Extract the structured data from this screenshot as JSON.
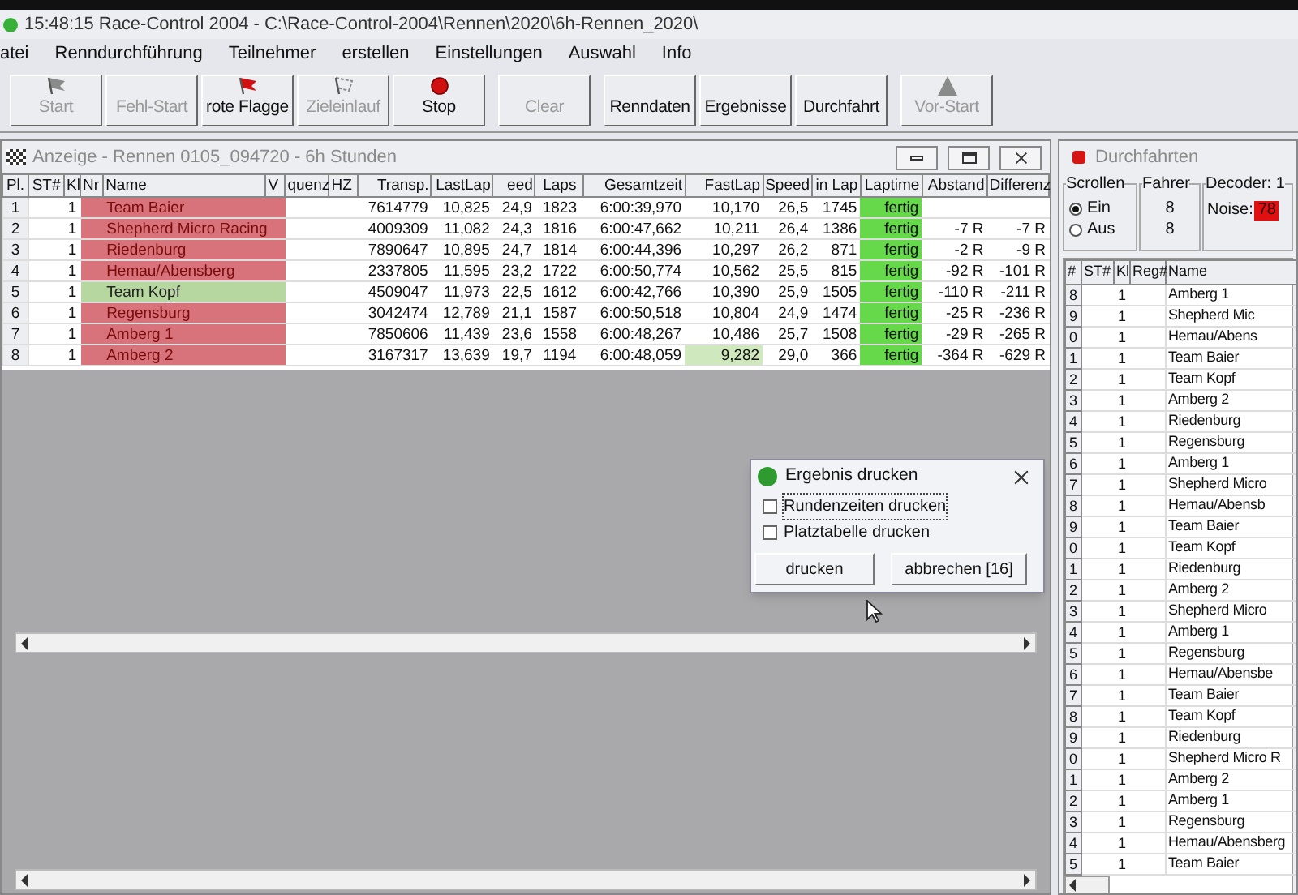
{
  "window": {
    "title": "15:48:15 Race-Control 2004 - C:\\Race-Control-2004\\Rennen\\2020\\6h-Rennen_2020\\"
  },
  "menu": [
    "atei",
    "Renndurchführung",
    "Teilnehmer",
    "erstellen",
    "Einstellungen",
    "Auswahl",
    "Info"
  ],
  "toolbar": [
    [
      {
        "label": "Start",
        "disabled": true,
        "kind": "flag"
      },
      {
        "label": "Fehl-Start",
        "disabled": true,
        "kind": "plain"
      },
      {
        "label": "rote Flagge",
        "disabled": false,
        "kind": "flag"
      },
      {
        "label": "Zieleinlauf",
        "disabled": true,
        "kind": "checkered"
      },
      {
        "label": "Stop",
        "disabled": false,
        "kind": "stop"
      }
    ],
    [
      {
        "label": "Clear",
        "disabled": true,
        "kind": "plain"
      }
    ],
    [
      {
        "label": "Renndaten",
        "disabled": false,
        "kind": "plain"
      },
      {
        "label": "Ergebnisse",
        "disabled": false,
        "kind": "plain"
      },
      {
        "label": "Durchfahrt",
        "disabled": false,
        "kind": "plain"
      }
    ],
    [
      {
        "label": "Vor-Start",
        "disabled": true,
        "kind": "triangle"
      }
    ]
  ],
  "race_window": {
    "title": "Anzeige - Rennen 0105_094720 - 6h Stunden",
    "columns": [
      "Pl.",
      "ST#",
      "Kl",
      "Nr",
      "Name",
      "V",
      "quenz",
      "HZ",
      "Transp.",
      "LastLap",
      "eed",
      "Laps",
      "Gesamtzeit",
      "FastLap",
      "Speed",
      "in Lap",
      "Laptime",
      "Abstand",
      "Differenz"
    ],
    "rows": [
      {
        "pl": "1",
        "kl": "1",
        "name": "Team Baier",
        "color": "#d9737b",
        "transp": "7614779",
        "last_lap": "10,825",
        "speed_last": "24,9",
        "laps": "1823",
        "total": "6:00:39,970",
        "fast_lap": "10,170",
        "best_lap": false,
        "speed": "26,5",
        "in_lap": "1745",
        "laptime": "fertig",
        "gap": "",
        "diff": ""
      },
      {
        "pl": "2",
        "kl": "1",
        "name": "Shepherd Micro Racing",
        "color": "#d9737b",
        "transp": "4009309",
        "last_lap": "11,082",
        "speed_last": "24,3",
        "laps": "1816",
        "total": "6:00:47,662",
        "fast_lap": "10,211",
        "best_lap": false,
        "speed": "26,4",
        "in_lap": "1386",
        "laptime": "fertig",
        "gap": "-7 R",
        "diff": "-7 R"
      },
      {
        "pl": "3",
        "kl": "1",
        "name": "Riedenburg",
        "color": "#d9737b",
        "transp": "7890647",
        "last_lap": "10,895",
        "speed_last": "24,7",
        "laps": "1814",
        "total": "6:00:44,396",
        "fast_lap": "10,297",
        "best_lap": false,
        "speed": "26,2",
        "in_lap": "871",
        "laptime": "fertig",
        "gap": "-2 R",
        "diff": "-9 R"
      },
      {
        "pl": "4",
        "kl": "1",
        "name": "Hemau/Abensberg",
        "color": "#d9737b",
        "transp": "2337805",
        "last_lap": "11,595",
        "speed_last": "23,2",
        "laps": "1722",
        "total": "6:00:50,774",
        "fast_lap": "10,562",
        "best_lap": false,
        "speed": "25,5",
        "in_lap": "815",
        "laptime": "fertig",
        "gap": "-92 R",
        "diff": "-101 R"
      },
      {
        "pl": "5",
        "kl": "1",
        "name": "Team Kopf",
        "color": "#b6d7a0",
        "transp": "4509047",
        "last_lap": "11,973",
        "speed_last": "22,5",
        "laps": "1612",
        "total": "6:00:42,766",
        "fast_lap": "10,390",
        "best_lap": false,
        "speed": "25,9",
        "in_lap": "1505",
        "laptime": "fertig",
        "gap": "-110 R",
        "diff": "-211 R"
      },
      {
        "pl": "6",
        "kl": "1",
        "name": "Regensburg",
        "color": "#d9737b",
        "transp": "3042474",
        "last_lap": "12,789",
        "speed_last": "21,1",
        "laps": "1587",
        "total": "6:00:50,518",
        "fast_lap": "10,804",
        "best_lap": false,
        "speed": "24,9",
        "in_lap": "1474",
        "laptime": "fertig",
        "gap": "-25 R",
        "diff": "-236 R"
      },
      {
        "pl": "7",
        "kl": "1",
        "name": "Amberg 1",
        "color": "#d9737b",
        "transp": "7850606",
        "last_lap": "11,439",
        "speed_last": "23,6",
        "laps": "1558",
        "total": "6:00:48,267",
        "fast_lap": "10,486",
        "best_lap": false,
        "speed": "25,7",
        "in_lap": "1508",
        "laptime": "fertig",
        "gap": "-29 R",
        "diff": "-265 R"
      },
      {
        "pl": "8",
        "kl": "1",
        "name": "Amberg 2",
        "color": "#d9737b",
        "transp": "3167317",
        "last_lap": "13,639",
        "speed_last": "19,7",
        "laps": "1194",
        "total": "6:00:48,059",
        "fast_lap": "9,282",
        "best_lap": true,
        "speed": "29,0",
        "in_lap": "366",
        "laptime": "fertig",
        "gap": "-364 R",
        "diff": "-629 R"
      }
    ]
  },
  "passes_window": {
    "title": "Durchfahrten",
    "scroll_group": {
      "label": "Scrollen",
      "options": [
        {
          "label": "Ein",
          "selected": true
        },
        {
          "label": "Aus",
          "selected": false
        }
      ]
    },
    "driver_group": {
      "label": "Fahrer",
      "values": [
        "8",
        "8"
      ]
    },
    "decoder_group": {
      "label": "Decoder: 1",
      "noise_label": "Noise:",
      "noise_value": "78"
    },
    "columns": [
      "#",
      "ST#",
      "Kl",
      "Reg#",
      "Name"
    ],
    "rows": [
      {
        "num": "8",
        "kl": "1",
        "name": "Amberg 1"
      },
      {
        "num": "9",
        "kl": "1",
        "name": "Shepherd Mic"
      },
      {
        "num": "0",
        "kl": "1",
        "name": "Hemau/Abens"
      },
      {
        "num": "1",
        "kl": "1",
        "name": "Team Baier"
      },
      {
        "num": "2",
        "kl": "1",
        "name": "Team Kopf"
      },
      {
        "num": "3",
        "kl": "1",
        "name": "Amberg 2"
      },
      {
        "num": "4",
        "kl": "1",
        "name": "Riedenburg"
      },
      {
        "num": "5",
        "kl": "1",
        "name": "Regensburg"
      },
      {
        "num": "6",
        "kl": "1",
        "name": "Amberg 1"
      },
      {
        "num": "7",
        "kl": "1",
        "name": "Shepherd Micro"
      },
      {
        "num": "8",
        "kl": "1",
        "name": "Hemau/Abensb"
      },
      {
        "num": "9",
        "kl": "1",
        "name": "Team Baier"
      },
      {
        "num": "0",
        "kl": "1",
        "name": "Team Kopf"
      },
      {
        "num": "1",
        "kl": "1",
        "name": "Riedenburg"
      },
      {
        "num": "2",
        "kl": "1",
        "name": "Amberg 2"
      },
      {
        "num": "3",
        "kl": "1",
        "name": "Shepherd Micro"
      },
      {
        "num": "4",
        "kl": "1",
        "name": "Amberg 1"
      },
      {
        "num": "5",
        "kl": "1",
        "name": "Regensburg"
      },
      {
        "num": "6",
        "kl": "1",
        "name": "Hemau/Abensbe"
      },
      {
        "num": "7",
        "kl": "1",
        "name": "Team Baier"
      },
      {
        "num": "8",
        "kl": "1",
        "name": "Team Kopf"
      },
      {
        "num": "9",
        "kl": "1",
        "name": "Riedenburg"
      },
      {
        "num": "0",
        "kl": "1",
        "name": "Shepherd Micro R"
      },
      {
        "num": "1",
        "kl": "1",
        "name": "Amberg 2"
      },
      {
        "num": "2",
        "kl": "1",
        "name": "Amberg 1"
      },
      {
        "num": "3",
        "kl": "1",
        "name": "Regensburg"
      },
      {
        "num": "4",
        "kl": "1",
        "name": "Hemau/Abensberg"
      },
      {
        "num": "5",
        "kl": "1",
        "name": "Team Baier"
      }
    ]
  },
  "dialog": {
    "title": "Ergebnis drucken",
    "options": [
      {
        "label": "Rundenzeiten drucken",
        "checked": false,
        "focused": true
      },
      {
        "label": "Platztabelle drucken",
        "checked": false,
        "focused": false
      }
    ],
    "buttons": [
      "drucken",
      "abbrechen [16]"
    ]
  }
}
